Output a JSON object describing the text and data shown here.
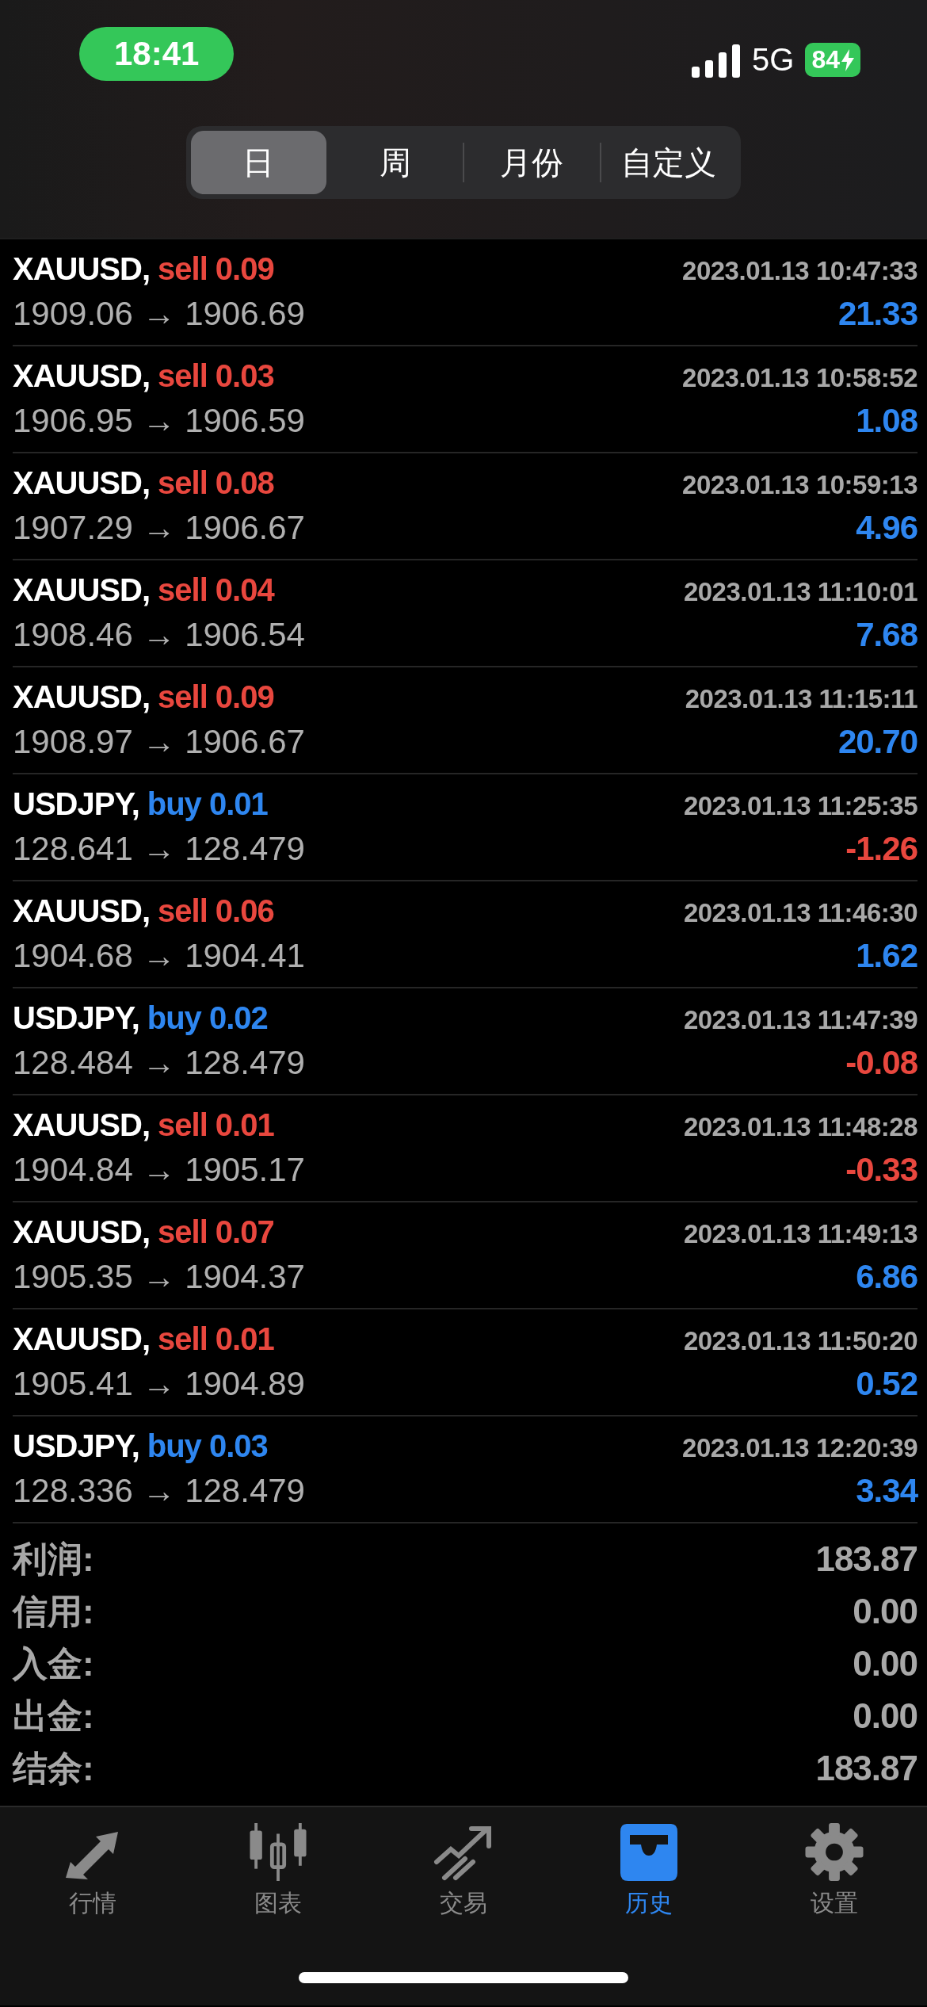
{
  "status_bar": {
    "time": "18:41",
    "network": "5G",
    "battery": "84"
  },
  "period_tabs": [
    {
      "label": "日",
      "selected": true
    },
    {
      "label": "周",
      "selected": false
    },
    {
      "label": "月份",
      "selected": false
    },
    {
      "label": "自定义",
      "selected": false
    }
  ],
  "deals": [
    {
      "symbol": "XAUUSD,",
      "kind": "sell",
      "volume": "sell 0.09",
      "time": "2023.01.13 10:47:33",
      "prices": "1909.06 → 1906.69",
      "profit": "21.33",
      "negative": false
    },
    {
      "symbol": "XAUUSD,",
      "kind": "sell",
      "volume": "sell 0.03",
      "time": "2023.01.13 10:58:52",
      "prices": "1906.95 → 1906.59",
      "profit": "1.08",
      "negative": false
    },
    {
      "symbol": "XAUUSD,",
      "kind": "sell",
      "volume": "sell 0.08",
      "time": "2023.01.13 10:59:13",
      "prices": "1907.29 → 1906.67",
      "profit": "4.96",
      "negative": false
    },
    {
      "symbol": "XAUUSD,",
      "kind": "sell",
      "volume": "sell 0.04",
      "time": "2023.01.13 11:10:01",
      "prices": "1908.46 → 1906.54",
      "profit": "7.68",
      "negative": false
    },
    {
      "symbol": "XAUUSD,",
      "kind": "sell",
      "volume": "sell 0.09",
      "time": "2023.01.13 11:15:11",
      "prices": "1908.97 → 1906.67",
      "profit": "20.70",
      "negative": false
    },
    {
      "symbol": "USDJPY,",
      "kind": "buy",
      "volume": "buy 0.01",
      "time": "2023.01.13 11:25:35",
      "prices": "128.641 → 128.479",
      "profit": "-1.26",
      "negative": true
    },
    {
      "symbol": "XAUUSD,",
      "kind": "sell",
      "volume": "sell 0.06",
      "time": "2023.01.13 11:46:30",
      "prices": "1904.68 → 1904.41",
      "profit": "1.62",
      "negative": false
    },
    {
      "symbol": "USDJPY,",
      "kind": "buy",
      "volume": "buy 0.02",
      "time": "2023.01.13 11:47:39",
      "prices": "128.484 → 128.479",
      "profit": "-0.08",
      "negative": true
    },
    {
      "symbol": "XAUUSD,",
      "kind": "sell",
      "volume": "sell 0.01",
      "time": "2023.01.13 11:48:28",
      "prices": "1904.84 → 1905.17",
      "profit": "-0.33",
      "negative": true
    },
    {
      "symbol": "XAUUSD,",
      "kind": "sell",
      "volume": "sell 0.07",
      "time": "2023.01.13 11:49:13",
      "prices": "1905.35 → 1904.37",
      "profit": "6.86",
      "negative": false
    },
    {
      "symbol": "XAUUSD,",
      "kind": "sell",
      "volume": "sell 0.01",
      "time": "2023.01.13 11:50:20",
      "prices": "1905.41 → 1904.89",
      "profit": "0.52",
      "negative": false
    },
    {
      "symbol": "USDJPY,",
      "kind": "buy",
      "volume": "buy 0.03",
      "time": "2023.01.13 12:20:39",
      "prices": "128.336 → 128.479",
      "profit": "3.34",
      "negative": false
    }
  ],
  "summary": [
    {
      "label": "利润:",
      "value": "183.87"
    },
    {
      "label": "信用:",
      "value": "0.00"
    },
    {
      "label": "入金:",
      "value": "0.00"
    },
    {
      "label": "出金:",
      "value": "0.00"
    },
    {
      "label": "结余:",
      "value": "183.87"
    }
  ],
  "bottom_tabs": [
    {
      "kind": "quotes",
      "label": "行情",
      "selected": false
    },
    {
      "kind": "chart",
      "label": "图表",
      "selected": false
    },
    {
      "kind": "trade",
      "label": "交易",
      "selected": false
    },
    {
      "kind": "history",
      "label": "历史",
      "selected": true
    },
    {
      "kind": "settings",
      "label": "设置",
      "selected": false
    }
  ]
}
